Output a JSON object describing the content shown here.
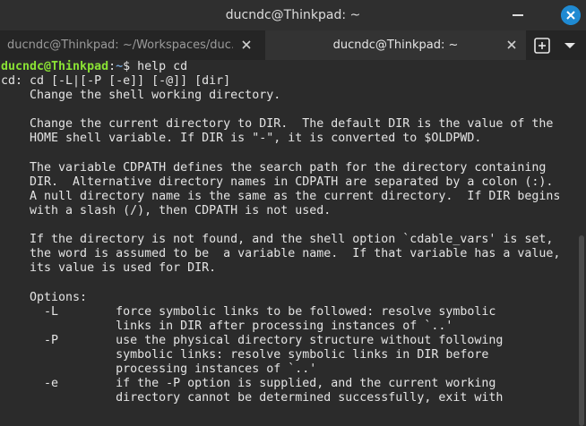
{
  "window": {
    "title": "ducndc@Thinkpad: ~",
    "colors": {
      "titlebar": "#2f2f2f",
      "close_accent": "#1f8ad2",
      "terminal_bg": "#2b2b2b",
      "prompt_user": "#8ae234",
      "prompt_path": "#729fcf"
    }
  },
  "tabs": [
    {
      "label": "ducndc@Thinkpad: ~/Workspaces/duc...",
      "active": false,
      "close_icon": "close-icon"
    },
    {
      "label": "ducndc@Thinkpad: ~",
      "active": true,
      "close_icon": "close-icon"
    }
  ],
  "toolbar": {
    "new_tab_icon": "plus-square-icon",
    "menu_icon": "chevron-down-icon"
  },
  "prompt": {
    "user_host": "ducndc@Thinkpad",
    "colon": ":",
    "path": "~",
    "symbol": "$ ",
    "command": "help cd"
  },
  "output": [
    "cd: cd [-L|[-P [-e]] [-@]] [dir]",
    "    Change the shell working directory.",
    "",
    "    Change the current directory to DIR.  The default DIR is the value of the",
    "    HOME shell variable. If DIR is \"-\", it is converted to $OLDPWD.",
    "",
    "    The variable CDPATH defines the search path for the directory containing",
    "    DIR.  Alternative directory names in CDPATH are separated by a colon (:).",
    "    A null directory name is the same as the current directory.  If DIR begins",
    "    with a slash (/), then CDPATH is not used.",
    "",
    "    If the directory is not found, and the shell option `cdable_vars' is set,",
    "    the word is assumed to be  a variable name.  If that variable has a value,",
    "    its value is used for DIR.",
    "",
    "    Options:",
    "      -L        force symbolic links to be followed: resolve symbolic",
    "                links in DIR after processing instances of `..'",
    "      -P        use the physical directory structure without following",
    "                symbolic links: resolve symbolic links in DIR before",
    "                processing instances of `..'",
    "      -e        if the -P option is supplied, and the current working",
    "                directory cannot be determined successfully, exit with"
  ]
}
